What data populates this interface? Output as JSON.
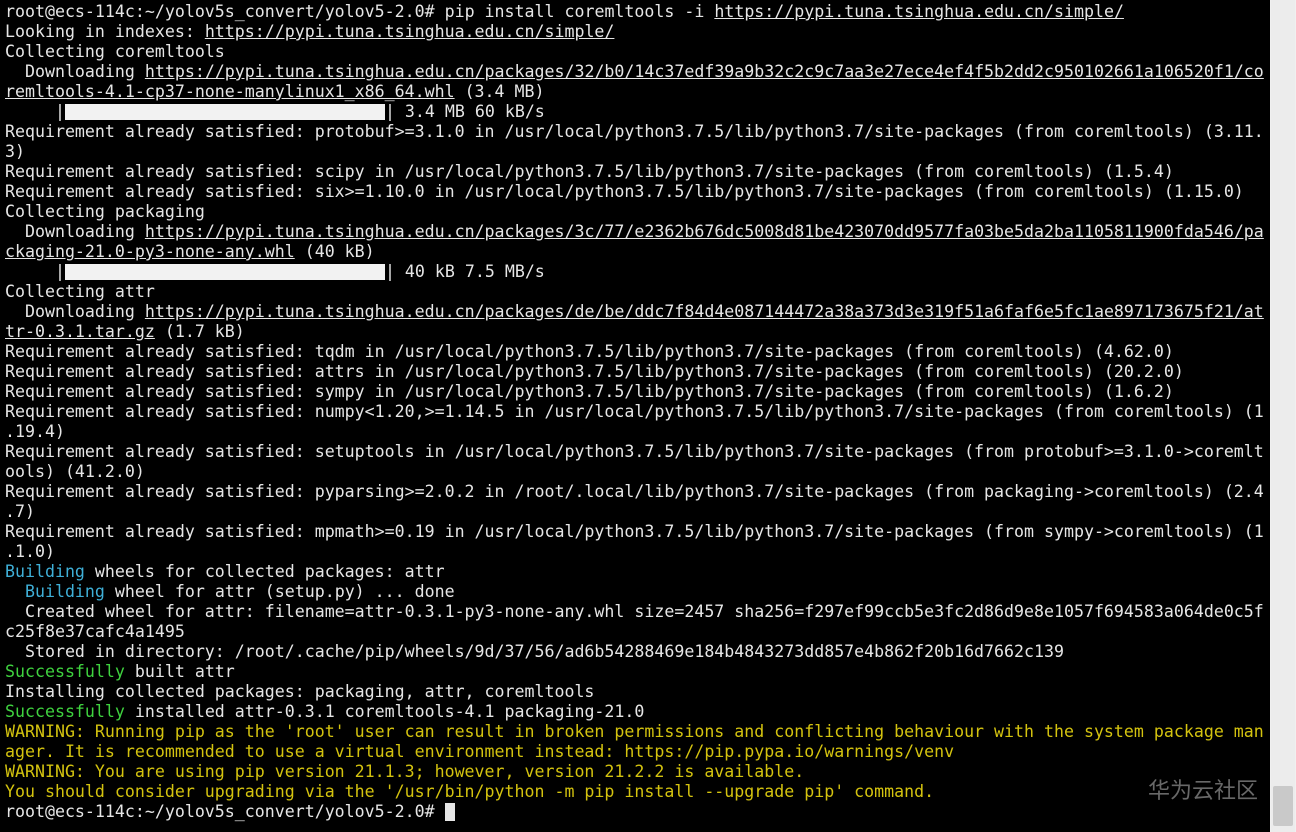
{
  "colors": {
    "background": "#000000",
    "text": "#e6e6e6",
    "cyan": "#3fb0d8",
    "green": "#3fd33f",
    "yellow": "#d4c30f"
  },
  "terminal": {
    "prompt": "root@ecs-114c:~/yolov5s_convert/yolov5-2.0#",
    "command": "pip install coremltools -i ",
    "command_url": "https://pypi.tuna.tsinghua.edu.cn/simple/",
    "index_prefix": "Looking in indexes: ",
    "index_url": "https://pypi.tuna.tsinghua.edu.cn/simple/",
    "collect_coremltools": "Collecting coremltools",
    "dl1_prefix": "  Downloading ",
    "dl1_url_a": "https://pypi.tuna.tsinghua.edu.cn/packages/32/b0/14c37edf39a9b32c2c9c7aa3e27ece4ef4f5b2dd2c950102661a106520f1/co",
    "dl1_url_b": "remltools-4.1-cp37-none-manylinux1_x86_64.whl",
    "dl1_size": " (3.4 MB)",
    "prog1_pipe": "     |",
    "prog1_fraction": 1.0,
    "prog1_stats": "| 3.4 MB 60 kB/s",
    "req_protobuf_a": "Requirement already satisfied: protobuf>=3.1.0 in /usr/local/python3.7.5/lib/python3.7/site-packages (from coremltools) (3.11.",
    "req_protobuf_b": "3)",
    "req_scipy": "Requirement already satisfied: scipy in /usr/local/python3.7.5/lib/python3.7/site-packages (from coremltools) (1.5.4)",
    "req_six": "Requirement already satisfied: six>=1.10.0 in /usr/local/python3.7.5/lib/python3.7/site-packages (from coremltools) (1.15.0)",
    "collect_packaging": "Collecting packaging",
    "dl2_prefix": "  Downloading ",
    "dl2_url_a": "https://pypi.tuna.tsinghua.edu.cn/packages/3c/77/e2362b676dc5008d81be423070dd9577fa03be5da2ba1105811900fda546/pa",
    "dl2_url_b": "ckaging-21.0-py3-none-any.whl",
    "dl2_size": " (40 kB)",
    "prog2_pipe": "     |",
    "prog2_fraction": 1.0,
    "prog2_stats": "| 40 kB 7.5 MB/s",
    "collect_attr": "Collecting attr",
    "dl3_prefix": "  Downloading ",
    "dl3_url_a": "https://pypi.tuna.tsinghua.edu.cn/packages/de/be/ddc7f84d4e087144472a38a373d3e319f51a6faf6e5fc1ae897173675f21/at",
    "dl3_url_b": "tr-0.3.1.tar.gz",
    "dl3_size": " (1.7 kB)",
    "req_tqdm": "Requirement already satisfied: tqdm in /usr/local/python3.7.5/lib/python3.7/site-packages (from coremltools) (4.62.0)",
    "req_attrs": "Requirement already satisfied: attrs in /usr/local/python3.7.5/lib/python3.7/site-packages (from coremltools) (20.2.0)",
    "req_sympy": "Requirement already satisfied: sympy in /usr/local/python3.7.5/lib/python3.7/site-packages (from coremltools) (1.6.2)",
    "req_numpy_a": "Requirement already satisfied: numpy<1.20,>=1.14.5 in /usr/local/python3.7.5/lib/python3.7/site-packages (from coremltools) (1",
    "req_numpy_b": ".19.4)",
    "req_setuptools_a": "Requirement already satisfied: setuptools in /usr/local/python3.7.5/lib/python3.7/site-packages (from protobuf>=3.1.0->coremlt",
    "req_setuptools_b": "ools) (41.2.0)",
    "req_pyparsing_a": "Requirement already satisfied: pyparsing>=2.0.2 in /root/.local/lib/python3.7/site-packages (from packaging->coremltools) (2.4",
    "req_pyparsing_b": ".7)",
    "req_mpmath_a": "Requirement already satisfied: mpmath>=0.19 in /usr/local/python3.7.5/lib/python3.7/site-packages (from sympy->coremltools) (1",
    "req_mpmath_b": ".1.0)",
    "building_word": "Building",
    "building_rest": " wheels for collected packages: attr",
    "building2_indent": "  ",
    "building2_word": "Building",
    "building2_rest": " wheel for attr (setup.py) ... done",
    "created_a": "  Created wheel for attr: filename=attr-0.3.1-py3-none-any.whl size=2457 sha256=f297ef99ccb5e3fc2d86d9e8e1057f694583a064de0c5f",
    "created_b": "c25f8e37cafc4a1495",
    "stored": "  Stored in directory: /root/.cache/pip/wheels/9d/37/56/ad6b54288469e184b4843273dd857e4b862f20b16d7662c139",
    "success1_word": "Successfully",
    "success1_rest": " built attr",
    "installing": "Installing collected packages: packaging, attr, coremltools",
    "success2_word": "Successfully",
    "success2_rest": " installed attr-0.3.1 coremltools-4.1 packaging-21.0",
    "warn1_a": "WARNING: Running pip as the 'root' user can result in broken permissions and conflicting behaviour with the system package man",
    "warn1_b": "ager. It is recommended to use a virtual environment instead: https://pip.pypa.io/warnings/venv",
    "warn2": "WARNING: You are using pip version 21.1.3; however, version 21.2.2 is available.",
    "warn3": "You should consider upgrading via the '/usr/bin/python -m pip install --upgrade pip' command.",
    "final_prompt": "root@ecs-114c:~/yolov5s_convert/yolov5-2.0# "
  },
  "watermark": "华为云社区"
}
